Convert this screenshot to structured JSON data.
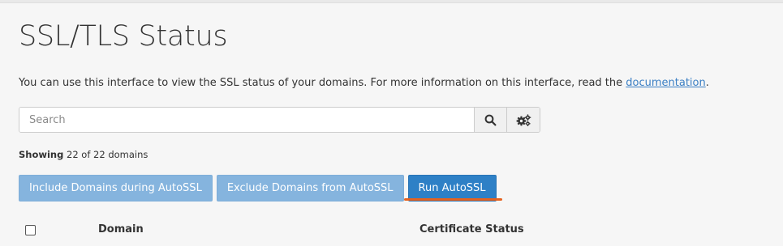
{
  "page": {
    "title": "SSL/TLS Status"
  },
  "intro": {
    "text": "You can use this interface to view the SSL status of your domains. For more information on this interface, read the ",
    "link_label": "documentation",
    "suffix": "."
  },
  "search": {
    "placeholder": "Search",
    "value": "",
    "search_icon": "search-icon",
    "settings_icon": "gears-icon"
  },
  "showing": {
    "label": "Showing",
    "text": "22 of 22 domains"
  },
  "actions": {
    "include_label": "Include Domains during AutoSSL",
    "exclude_label": "Exclude Domains from AutoSSL",
    "run_label": "Run AutoSSL"
  },
  "table": {
    "columns": [
      "Domain",
      "Certificate Status"
    ]
  },
  "colors": {
    "accent": "#2e80c6",
    "muted_button": "#85b4de",
    "highlight": "#e5621f",
    "link": "#3b7fc4"
  }
}
